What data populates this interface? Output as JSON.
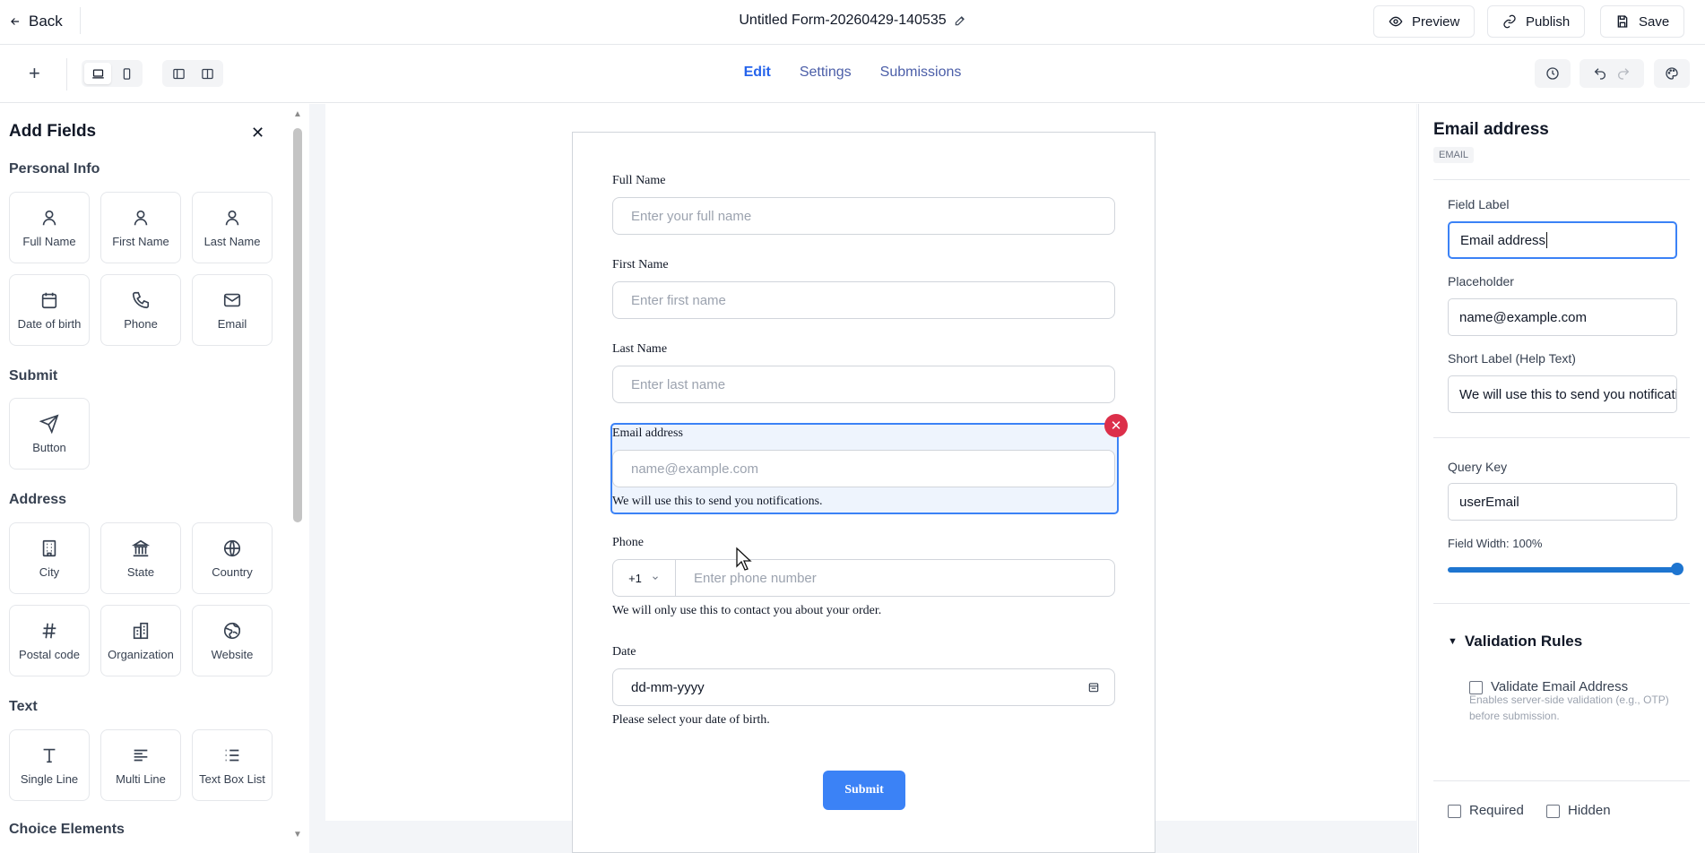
{
  "header": {
    "back_label": "Back",
    "form_title": "Untitled Form-20260429-140535",
    "preview_label": "Preview",
    "publish_label": "Publish",
    "save_label": "Save"
  },
  "toolbar": {
    "add_label": "+",
    "tabs": [
      {
        "label": "Edit",
        "active": true
      },
      {
        "label": "Settings",
        "active": false
      },
      {
        "label": "Submissions",
        "active": false
      }
    ]
  },
  "left_panel": {
    "title": "Add Fields",
    "sections": [
      {
        "title": "Personal Info",
        "items": [
          {
            "label": "Full Name",
            "icon": "user-icon"
          },
          {
            "label": "First Name",
            "icon": "user-icon"
          },
          {
            "label": "Last Name",
            "icon": "user-icon"
          },
          {
            "label": "Date of birth",
            "icon": "calendar-icon"
          },
          {
            "label": "Phone",
            "icon": "phone-icon"
          },
          {
            "label": "Email",
            "icon": "mail-icon"
          }
        ]
      },
      {
        "title": "Submit",
        "items": [
          {
            "label": "Button",
            "icon": "send-icon"
          }
        ]
      },
      {
        "title": "Address",
        "items": [
          {
            "label": "City",
            "icon": "building-icon"
          },
          {
            "label": "State",
            "icon": "landmark-icon"
          },
          {
            "label": "Country",
            "icon": "globe-icon"
          },
          {
            "label": "Postal code",
            "icon": "hash-icon"
          },
          {
            "label": "Organization",
            "icon": "organization-icon"
          },
          {
            "label": "Website",
            "icon": "earth-icon"
          }
        ]
      },
      {
        "title": "Text",
        "items": [
          {
            "label": "Single Line",
            "icon": "text-icon"
          },
          {
            "label": "Multi Line",
            "icon": "align-left-icon"
          },
          {
            "label": "Text Box List",
            "icon": "list-icon"
          }
        ]
      },
      {
        "title": "Choice Elements",
        "items": []
      }
    ]
  },
  "form": {
    "full_name": {
      "label": "Full Name",
      "placeholder": "Enter your full name"
    },
    "first_name": {
      "label": "First Name",
      "placeholder": "Enter first name"
    },
    "last_name": {
      "label": "Last Name",
      "placeholder": "Enter last name"
    },
    "email": {
      "label": "Email address",
      "placeholder": "name@example.com",
      "help": "We will use this to send you notifications."
    },
    "phone": {
      "label": "Phone",
      "country_code": "+1",
      "placeholder": "Enter phone number",
      "help": "We will only use this to contact you about your order."
    },
    "date": {
      "label": "Date",
      "placeholder": "dd-mm-yyyy",
      "help": "Please select your date of birth."
    },
    "submit_label": "Submit"
  },
  "right_panel": {
    "title": "Email address",
    "type_tag": "EMAIL",
    "field_label_title": "Field Label",
    "field_label_value": "Email address",
    "placeholder_title": "Placeholder",
    "placeholder_value": "name@example.com",
    "short_label_title": "Short Label (Help Text)",
    "short_label_value": "We will use this to send you notifications.",
    "query_key_title": "Query Key",
    "query_key_value": "userEmail",
    "field_width_label": "Field Width: 100%",
    "field_width_percent": 100,
    "validation_title": "Validation Rules",
    "validate_email_label": "Validate Email Address",
    "validate_email_note": "Enables server-side validation (e.g., OTP) before submission.",
    "required_label": "Required",
    "hidden_label": "Hidden"
  },
  "colors": {
    "accent": "#3b82f6",
    "tab_active": "#2563eb",
    "delete": "#dc2f4a",
    "slider": "#1e75d0"
  }
}
